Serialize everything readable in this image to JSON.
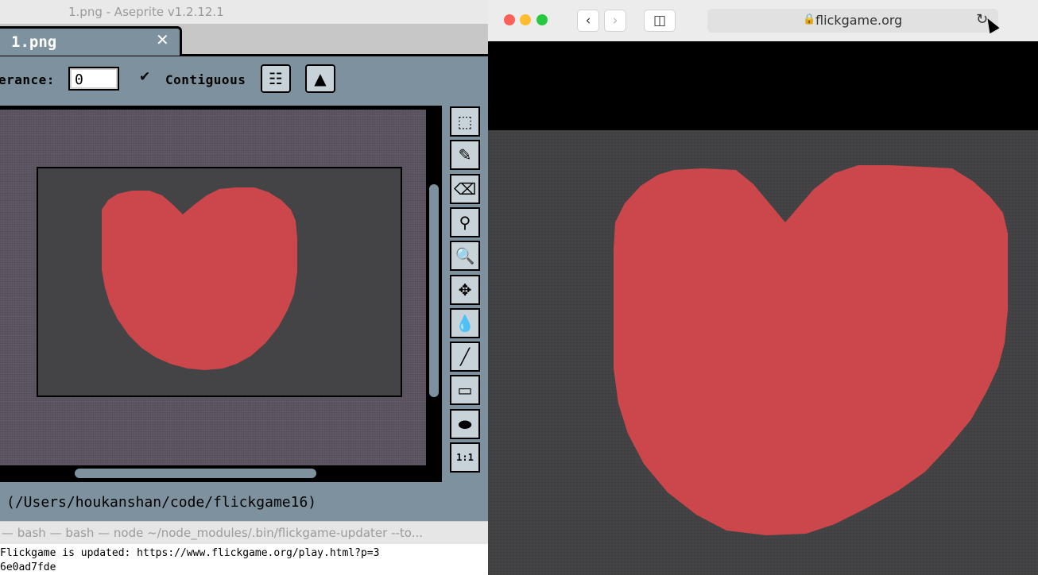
{
  "aseprite": {
    "window_title": "1.png - Aseprite v1.2.12.1",
    "tab": {
      "name": "1.png",
      "close": "✕"
    },
    "context_bar": {
      "tolerance_label": "erance:",
      "tolerance_value": "0",
      "contiguous_label": "Contiguous",
      "contiguous_checked": true
    },
    "tools": [
      {
        "icon": "rectangular-marquee-icon",
        "glyph": "⬚"
      },
      {
        "icon": "pencil-icon",
        "glyph": "✎"
      },
      {
        "icon": "eraser-icon",
        "glyph": "⌫"
      },
      {
        "icon": "eyedropper-icon",
        "glyph": "⚲"
      },
      {
        "icon": "zoom-icon",
        "glyph": "🔍"
      },
      {
        "icon": "move-icon",
        "glyph": "✥"
      },
      {
        "icon": "paint-bucket-icon",
        "glyph": "💧"
      },
      {
        "icon": "line-icon",
        "glyph": "╱"
      },
      {
        "icon": "rectangle-icon",
        "glyph": "▭"
      },
      {
        "icon": "contour-icon",
        "glyph": "⬬"
      },
      {
        "icon": "actual-size-icon",
        "glyph": "1:1"
      }
    ],
    "status_path": "(/Users/houkanshan/code/flickgame16)",
    "heart_color": "#cc474b",
    "canvas_color": "#444446"
  },
  "terminal": {
    "title": "— bash — bash — node ~/node_modules/.bin/flickgame-updater --to...",
    "lines": [
      "Flickgame is updated: https://www.flickgame.org/play.html?p=3",
      "6e0ad7fde"
    ]
  },
  "safari": {
    "url": "flickgame.org",
    "traffic_lights": {
      "close": "#fe5f57",
      "minimize": "#febc2e",
      "zoom": "#28c840"
    }
  }
}
